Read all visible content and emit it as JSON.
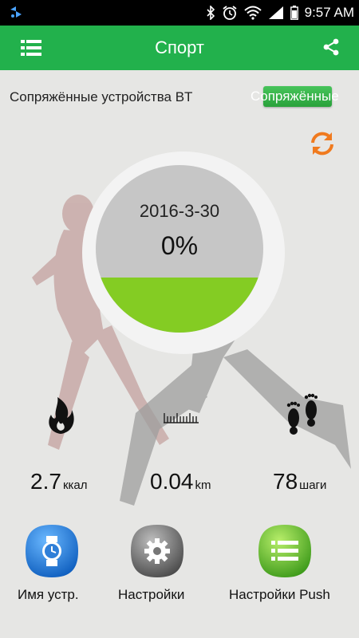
{
  "status_bar": {
    "time": "9:57 AM",
    "icons": [
      "app-notification-icon",
      "bluetooth-icon",
      "alarm-icon",
      "wifi-icon",
      "signal-icon",
      "battery-icon"
    ]
  },
  "app_bar": {
    "title": "Спорт",
    "menu_icon": "list-menu-icon",
    "share_icon": "share-icon"
  },
  "pairing": {
    "label": "Сопряжённые устройства BT",
    "button_label": "Сопряжённые",
    "refresh_icon": "refresh-icon"
  },
  "gauge": {
    "date": "2016-3-30",
    "percent_text": "0%"
  },
  "stats": {
    "calories": {
      "value": "2.7",
      "unit": "ккал",
      "icon": "flame-icon"
    },
    "distance": {
      "value": "0.04",
      "unit": "km",
      "icon": "ruler-icon"
    },
    "steps": {
      "value": "78",
      "unit": "шаги",
      "icon": "footprints-icon"
    }
  },
  "actions": [
    {
      "label": "Имя устр.",
      "icon": "watch-icon",
      "color": "#1e78d6"
    },
    {
      "label": "Настройки",
      "icon": "gear-icon",
      "color": "#707070"
    },
    {
      "label": "Настройки Push",
      "icon": "list-icon",
      "color": "#5cb82a"
    }
  ],
  "colors": {
    "accent": "#22b14c",
    "gauge_fill": "#84cc23",
    "refresh": "#f07a1e"
  }
}
